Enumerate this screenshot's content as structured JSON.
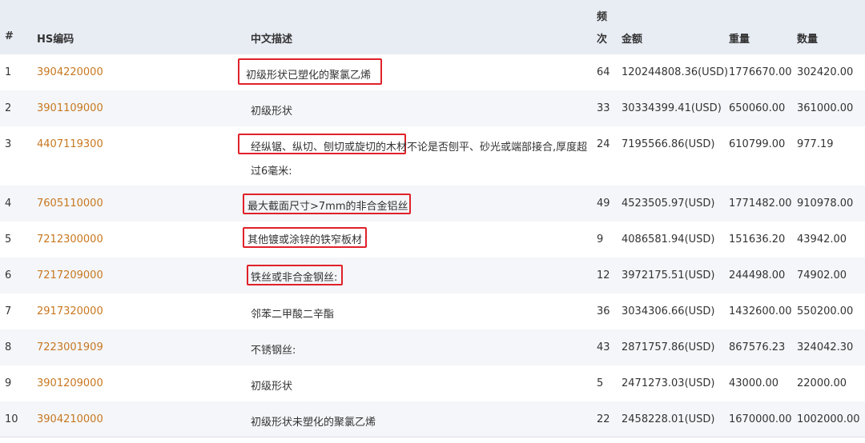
{
  "headers": {
    "index": "#",
    "hs_code": "HS编码",
    "description": "中文描述",
    "frequency_line1": "频",
    "frequency_line2": "次",
    "amount": "金额",
    "weight": "重量",
    "quantity": "数量"
  },
  "rows": [
    {
      "index": "1",
      "hs_code": "3904220000",
      "description": "初级形状已塑化的聚氯乙烯",
      "frequency": "64",
      "amount": "120244808.36(USD)",
      "weight": "1776670.00",
      "quantity": "302420.00"
    },
    {
      "index": "2",
      "hs_code": "3901109000",
      "description": "初级形状",
      "frequency": "33",
      "amount": "30334399.41(USD)",
      "weight": "650060.00",
      "quantity": "361000.00"
    },
    {
      "index": "3",
      "hs_code": "4407119300",
      "description_part1": "经纵锯、纵切、刨切或旋切的木材",
      "description_part2": "不论是否刨平、砂光或端部接合,厚度超",
      "description_line2": "过6毫米:",
      "frequency": "24",
      "amount": "7195566.86(USD)",
      "weight": "610799.00",
      "quantity": "977.19"
    },
    {
      "index": "4",
      "hs_code": "7605110000",
      "description": "最大截面尺寸>7mm的非合金铝丝",
      "frequency": "49",
      "amount": "4523505.97(USD)",
      "weight": "1771482.00",
      "quantity": "910978.00"
    },
    {
      "index": "5",
      "hs_code": "7212300000",
      "description": "其他镀或涂锌的铁窄板材",
      "frequency": "9",
      "amount": "4086581.94(USD)",
      "weight": "151636.20",
      "quantity": "43942.00"
    },
    {
      "index": "6",
      "hs_code": "7217209000",
      "description": "铁丝或非合金钢丝:",
      "frequency": "12",
      "amount": "3972175.51(USD)",
      "weight": "244498.00",
      "quantity": "74902.00"
    },
    {
      "index": "7",
      "hs_code": "2917320000",
      "description": "邻苯二甲酸二辛酯",
      "frequency": "36",
      "amount": "3034306.66(USD)",
      "weight": "1432600.00",
      "quantity": "550200.00"
    },
    {
      "index": "8",
      "hs_code": "7223001909",
      "description": "不锈钢丝:",
      "frequency": "43",
      "amount": "2871757.86(USD)",
      "weight": "867576.23",
      "quantity": "324042.30"
    },
    {
      "index": "9",
      "hs_code": "3901209000",
      "description": "初级形状",
      "frequency": "5",
      "amount": "2471273.03(USD)",
      "weight": "43000.00",
      "quantity": "22000.00"
    },
    {
      "index": "10",
      "hs_code": "3904210000",
      "description": "初级形状未塑化的聚氯乙烯",
      "frequency": "22",
      "amount": "2458228.01(USD)",
      "weight": "1670000.00",
      "quantity": "1002000.00"
    }
  ],
  "colors": {
    "header_bg": "#e8ecf3",
    "stripe_bg": "#f4f6f9",
    "hs_link": "#c8771f",
    "highlight_box": "#e0212a"
  }
}
